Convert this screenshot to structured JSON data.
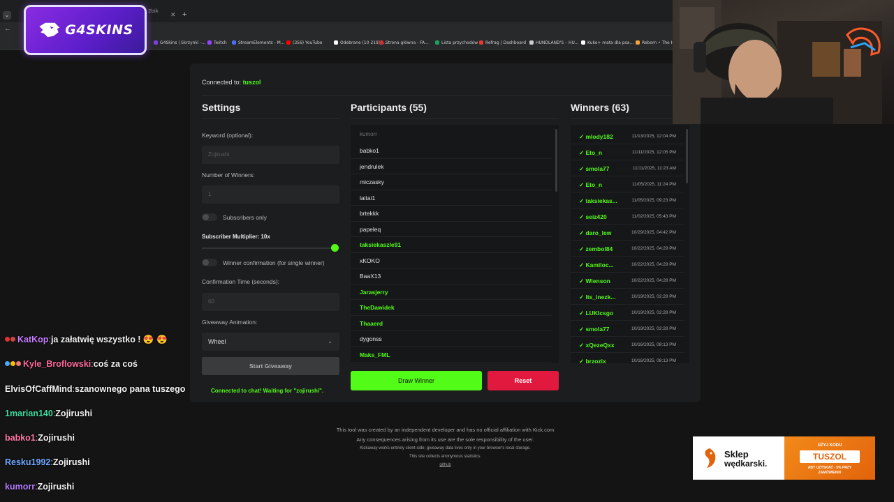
{
  "browser": {
    "tab_partial": "2bik",
    "bookmarks": [
      {
        "label": "G4Skins | Skrzynki -...",
        "color": "#7b3fe4"
      },
      {
        "label": "Twitch",
        "color": "#9146ff"
      },
      {
        "label": "StreamElements - M...",
        "color": "#4a6cf7"
      },
      {
        "label": "(356) YouTube",
        "color": "#ff0000"
      },
      {
        "label": "Odebrane (10 219) -...",
        "color": "#ffffff"
      },
      {
        "label": "Strona główna - FA...",
        "color": "#d32f2f"
      },
      {
        "label": "Lista przychodów",
        "color": "#1aa260"
      },
      {
        "label": "Refrag | Dashboard",
        "color": "#e53935"
      },
      {
        "label": "HUNDLAND'S – HU...",
        "color": "#cccccc"
      },
      {
        "label": "Kuko+ mata dla psa...",
        "color": "#ffffff"
      },
      {
        "label": "Reborn • The Ho",
        "color": "#f2a33a"
      }
    ]
  },
  "logo": {
    "text": "G4SKINS"
  },
  "app": {
    "connected_prefix": "Connected to:",
    "connected_channel": "tuszol",
    "settings": {
      "title": "Settings",
      "keyword_label": "Keyword (optional):",
      "keyword_placeholder": "Zojirushi",
      "winners_label": "Number of Winners:",
      "winners_value": "1",
      "subscribers_only": "Subscribers only",
      "multiplier_label": "Subscriber Multiplier: 10x",
      "multiplier_level": 1.0,
      "confirmation_toggle": "Winner confirmation (for single winner)",
      "confirmation_time_label": "Confirmation Time (seconds):",
      "confirmation_time_value": "60",
      "animation_label": "Giveaway Animation:",
      "animation_value": "Wheel",
      "start_button": "Start Giveaway",
      "status": "Connected to chat! Waiting for \"zojirushi\"."
    },
    "participants": {
      "title": "Participants (55)",
      "search_value": "kumorr",
      "items": [
        {
          "name": "babko1",
          "sub": false
        },
        {
          "name": "jendrulek",
          "sub": false
        },
        {
          "name": "miczasky",
          "sub": false
        },
        {
          "name": "laitai1",
          "sub": false
        },
        {
          "name": "brtekkk",
          "sub": false
        },
        {
          "name": "papeleq",
          "sub": false
        },
        {
          "name": "taksiekaszle91",
          "sub": true
        },
        {
          "name": "xKOKO",
          "sub": false
        },
        {
          "name": "BaaX13",
          "sub": false
        },
        {
          "name": "Jarasjerry",
          "sub": true
        },
        {
          "name": "TheDawidek",
          "sub": true
        },
        {
          "name": "Thaaerd",
          "sub": true
        },
        {
          "name": "dygonss",
          "sub": false
        },
        {
          "name": "Maks_FML",
          "sub": true
        }
      ],
      "draw_button": "Draw Winner",
      "reset_button": "Reset"
    },
    "winners": {
      "title": "Winners (63)",
      "items": [
        {
          "name": "✓ mlody182",
          "date": "11/13/2025, 12:04 PM"
        },
        {
          "name": "✓ Eto_n",
          "date": "11/11/2025, 12:05 PM"
        },
        {
          "name": "✓ smola77",
          "date": "11/11/2025, 11:23 AM"
        },
        {
          "name": "✓ Eto_n",
          "date": "11/05/2025, 11:24 PM"
        },
        {
          "name": "✓ taksiekas...",
          "date": "11/05/2025, 09:23 PM"
        },
        {
          "name": "✓ seiz420",
          "date": "11/02/2025, 05:43 PM"
        },
        {
          "name": "✓ daro_lew",
          "date": "10/29/2025, 04:42 PM"
        },
        {
          "name": "✓ zembol84",
          "date": "10/22/2025, 04:29 PM"
        },
        {
          "name": "✓ Kamiloc...",
          "date": "10/22/2025, 04:29 PM"
        },
        {
          "name": "✓ Wienson",
          "date": "10/22/2025, 04:28 PM"
        },
        {
          "name": "✓ Its_inezk...",
          "date": "10/19/2025, 02:29 PM"
        },
        {
          "name": "✓ LUKIcsgo",
          "date": "10/19/2025, 02:28 PM"
        },
        {
          "name": "✓ smola77",
          "date": "10/19/2025, 02:28 PM"
        },
        {
          "name": "✓ xQezeQxx",
          "date": "10/16/2025, 08:13 PM"
        },
        {
          "name": "✓ brzozix",
          "date": "10/16/2025, 08:13 PM"
        }
      ]
    }
  },
  "footer": {
    "line1": "This tool was created by an independent developer and has no official affiliation with Kick.com",
    "line2": "Any consequences arising from its use are the sole responsibility of the user.",
    "line3": "Kickaway works entirely client-side; giveaway data lives only in your browser's local storage.",
    "line4": "This site collects anonymous statistics.",
    "link": "github"
  },
  "chat": [
    {
      "user": "KatKop",
      "sep": ":",
      "msg": "ja załatwię wszystko ! 😍 😍",
      "color": "#c77dff",
      "badges": [
        "#d33",
        "#c44"
      ]
    },
    {
      "user": "Kyle_Broflowski",
      "sep": ":",
      "msg": "coś za coś",
      "color": "#ff6b9a",
      "badges": [
        "#4af",
        "#fb0",
        "#e77"
      ]
    },
    {
      "user": "ElvisOfCaffMind",
      "sep": ":",
      "msg": "szanownego pana tuszego",
      "color": "#f2f2f2",
      "badges": []
    },
    {
      "user": "1marian140",
      "sep": ":",
      "msg": "Zojirushi",
      "color": "#3ddca0",
      "badges": []
    },
    {
      "user": "babko1",
      "sep": ":",
      "msg": "Zojirushi",
      "color": "#ff7aa8",
      "badges": []
    },
    {
      "user": "Resku1992",
      "sep": ":",
      "msg": "Zojirushi",
      "color": "#6fa8ff",
      "badges": []
    },
    {
      "user": "kumorr",
      "sep": ":",
      "msg": "Zojirushi",
      "color": "#b57bff",
      "badges": []
    }
  ],
  "ad": {
    "brand_line1": "Sklep",
    "brand_line2": "wędkarski.",
    "promo_top": "UŻYJ KODU",
    "promo_code": "TUSZOL",
    "promo_line1": "ABY UZYSKAĆ - 5% PRZY",
    "promo_line2": "ZAMÓWIENIU"
  },
  "colors": {
    "accent": "#53fc18",
    "danger": "#e2193f",
    "panel": "#1c1d1f"
  }
}
